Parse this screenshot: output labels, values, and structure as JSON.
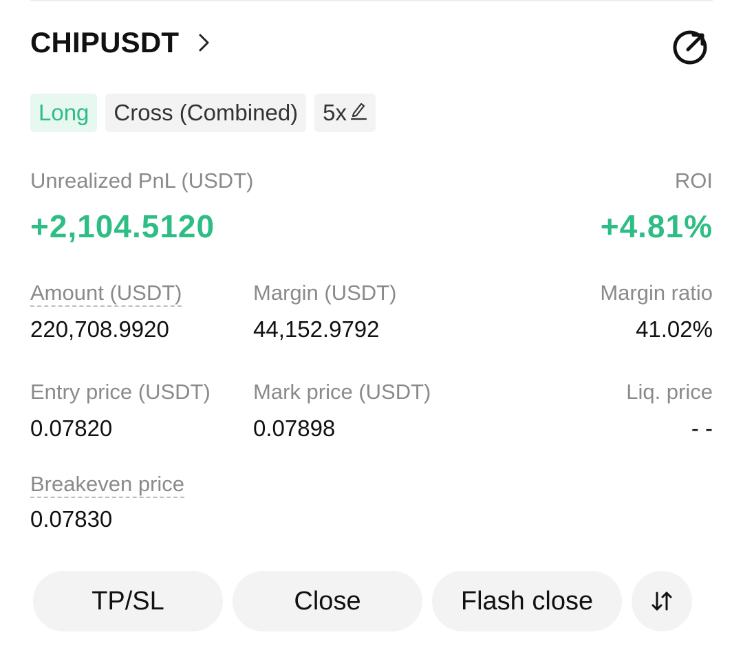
{
  "header": {
    "symbol": "CHIPUSDT",
    "chevron_icon": "chevron-right-icon",
    "share_icon": "share-arrow-circle-icon"
  },
  "tags": {
    "side": "Long",
    "margin_mode": "Cross (Combined)",
    "leverage": "5x",
    "leverage_edit_icon": "pencil-icon"
  },
  "pnl": {
    "unrealized_label": "Unrealized PnL (USDT)",
    "unrealized_value": "+2,104.5120",
    "roi_label": "ROI",
    "roi_value": "+4.81%"
  },
  "details": {
    "amount_label": "Amount (USDT)",
    "amount_value": "220,708.9920",
    "margin_label": "Margin (USDT)",
    "margin_value": "44,152.9792",
    "margin_ratio_label": "Margin ratio",
    "margin_ratio_value": "41.02%",
    "entry_label": "Entry price (USDT)",
    "entry_value": "0.07820",
    "mark_label": "Mark price (USDT)",
    "mark_value": "0.07898",
    "liq_label": "Liq. price",
    "liq_value": "- -",
    "breakeven_label": "Breakeven price",
    "breakeven_value": "0.07830"
  },
  "actions": {
    "tpsl": "TP/SL",
    "close": "Close",
    "flash_close": "Flash close",
    "reverse_icon": "swap-vertical-icon"
  },
  "colors": {
    "profit_green": "#2ebd85",
    "long_tag_bg": "#e7f8f1",
    "pill_bg": "#f3f3f3",
    "label_gray": "#8a8a8a"
  }
}
